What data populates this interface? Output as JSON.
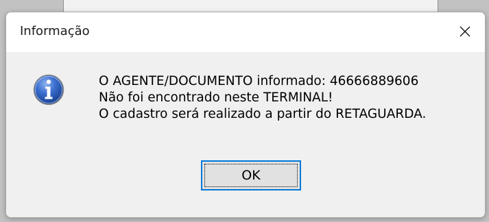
{
  "dialog": {
    "title": "Informação",
    "icon": "info-icon",
    "message_lines": [
      "O AGENTE/DOCUMENTO informado: 46666889606",
      "Não foi encontrado neste TERMINAL!",
      "O cadastro será realizado a partir do RETAGUARDA."
    ],
    "ok_label": "OK",
    "close_icon": "close-icon"
  },
  "colors": {
    "accent": "#0078d7",
    "info_icon_blue": "#2a5fb8"
  }
}
